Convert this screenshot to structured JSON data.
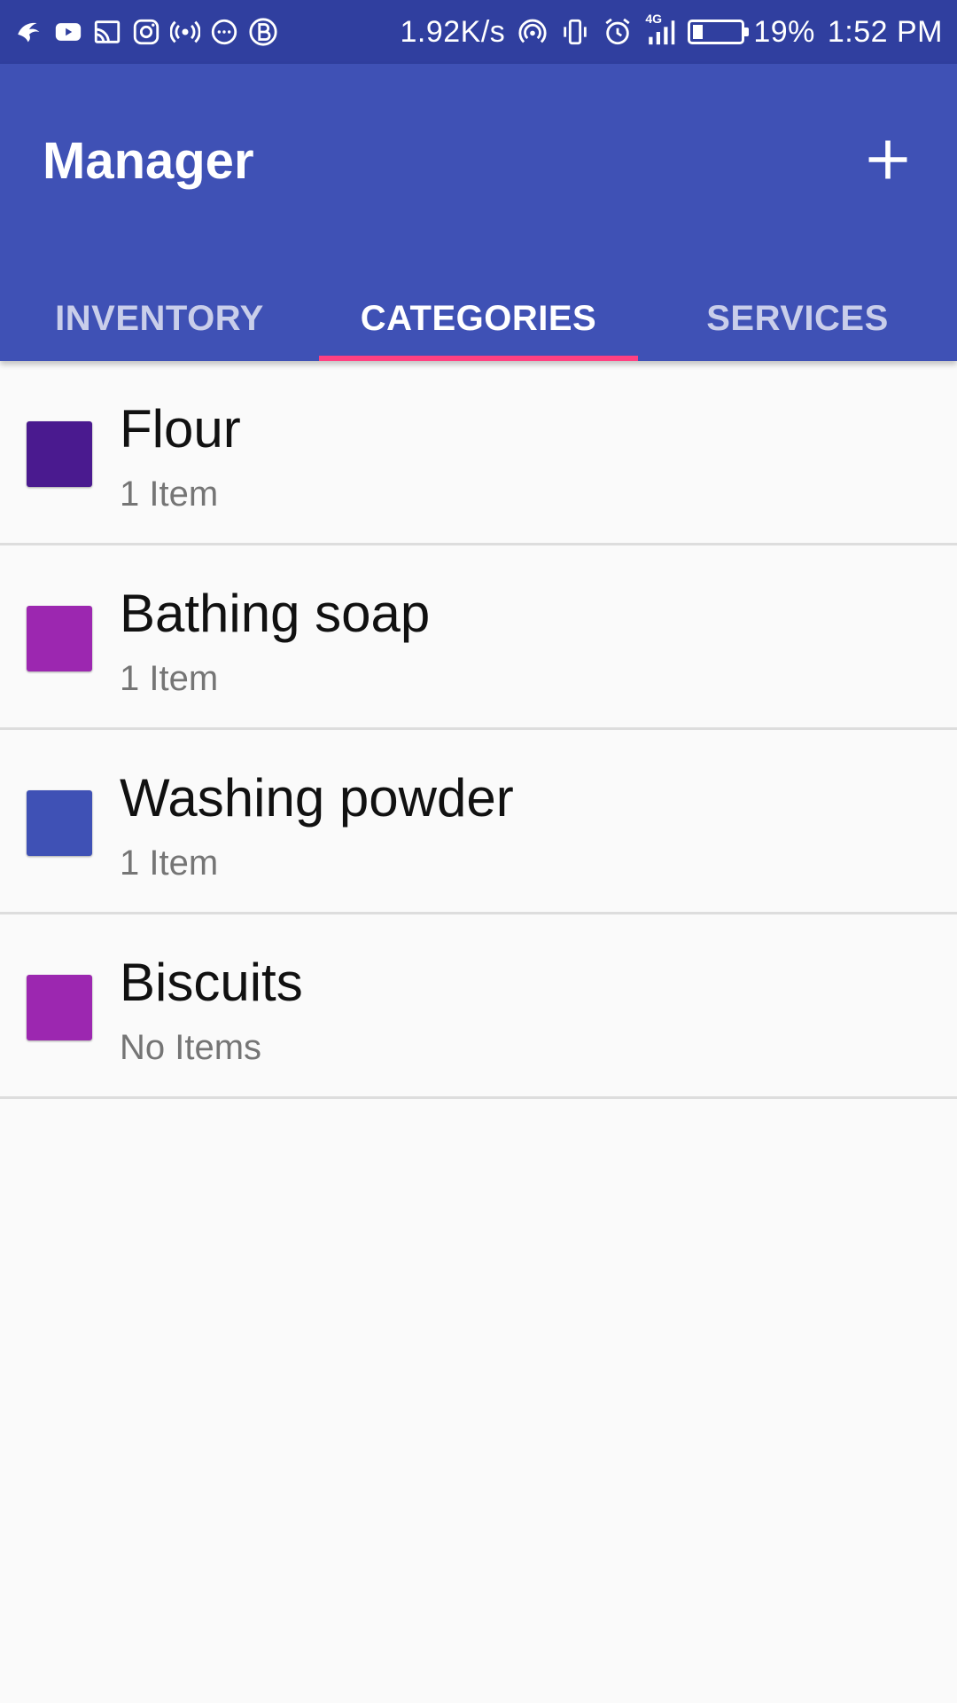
{
  "status_bar": {
    "network_speed": "1.92K/s",
    "network_type": "4G",
    "battery_percent": "19%",
    "battery_level": 0.19,
    "time": "1:52 PM",
    "left_icons": [
      "app-bird-icon",
      "youtube-icon",
      "cast-icon",
      "instagram-icon",
      "broadcast-icon",
      "messenger-icon",
      "b-app-icon"
    ],
    "right_icons": [
      "hotspot-icon",
      "vibrate-icon",
      "alarm-icon",
      "signal-icon",
      "battery-icon"
    ]
  },
  "app_bar": {
    "title": "Manager",
    "add_icon": "plus-icon",
    "background_color": "#3f51b5",
    "status_color": "#303f9f",
    "accent_color": "#ff4081"
  },
  "tabs": [
    {
      "label": "INVENTORY",
      "active": false
    },
    {
      "label": "CATEGORIES",
      "active": true
    },
    {
      "label": "SERVICES",
      "active": false
    }
  ],
  "categories": [
    {
      "name": "Flour",
      "count": "1 Item",
      "color": "#4a1a8f"
    },
    {
      "name": "Bathing soap",
      "count": "1 Item",
      "color": "#9c27b0"
    },
    {
      "name": "Washing powder",
      "count": "1 Item",
      "color": "#3f51b5"
    },
    {
      "name": "Biscuits",
      "count": "No Items",
      "color": "#9c27b0"
    }
  ]
}
